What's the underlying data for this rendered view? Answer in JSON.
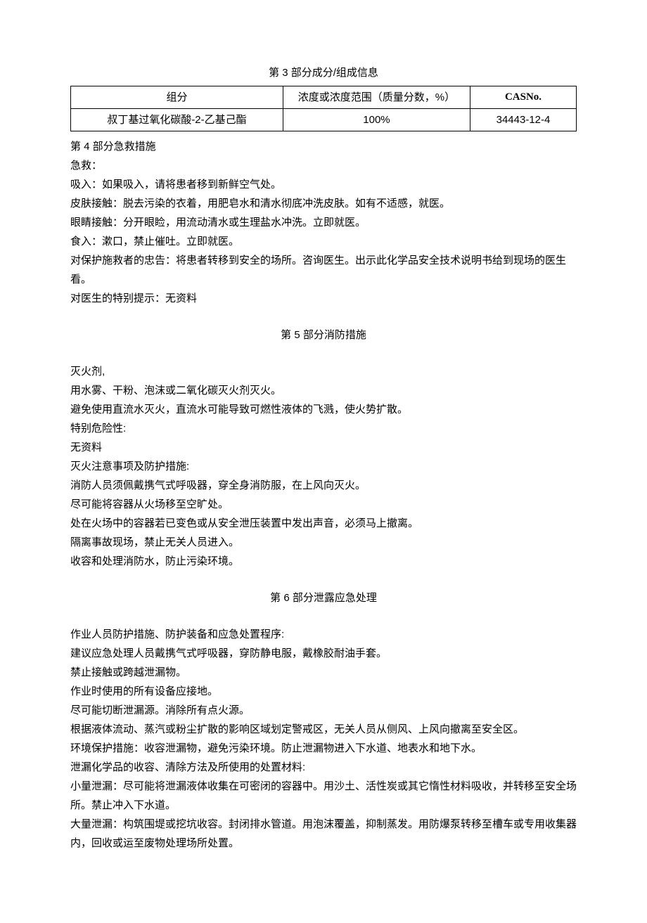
{
  "section3": {
    "title": "第 3 部分成分/组成信息",
    "table": {
      "headers": {
        "component": "组分",
        "concentration": "浓度或浓度范围（质量分数，%）",
        "cas": "CASNo."
      },
      "row": {
        "component": "叔丁基过氧化碳酸-2-乙基己酯",
        "concentration": "100%",
        "cas": "34443-12-4"
      }
    }
  },
  "section4": {
    "title": "第 4 部分急救措施",
    "lines": {
      "l1": "急救：",
      "l2": "吸入：如果吸入，请将患者移到新鲜空气处。",
      "l3": "皮肤接触：脱去污染的衣着，用肥皂水和清水彻底冲洗皮肤。如有不适感，就医。",
      "l4": "眼睛接触：分开眼睑，用流动清水或生理盐水冲洗。立即就医。",
      "l5": "食入：漱口，禁止催吐。立即就医。",
      "l6": "对保护施救者的忠告：将患者转移到安全的场所。咨询医生。出示此化学品安全技术说明书给到现场的医生看。",
      "l7": "对医生的特别提示：无资料"
    }
  },
  "section5": {
    "title": "第 5 部分消防措施",
    "lines": {
      "l1": "灭火剂,",
      "l2": "用水雾、干粉、泡沫或二氧化碳灭火剂灭火。",
      "l3": "避免使用直流水灭火，直流水可能导致可燃性液体的飞溅，使火势扩散。",
      "l4": "特别危险性:",
      "l5": "无资料",
      "l6": "灭火注意事项及防护措施:",
      "l7": "消防人员须佩戴携气式呼吸器，穿全身消防服，在上风向灭火。",
      "l8": "尽可能将容器从火场移至空旷处。",
      "l9": "处在火场中的容器若已变色或从安全泄压装置中发出声音，必须马上撤离。",
      "l10": "隔离事故现场，禁止无关人员进入。",
      "l11": "收容和处理消防水，防止污染环境。"
    }
  },
  "section6": {
    "title": "第 6 部分泄露应急处理",
    "lines": {
      "l1": "作业人员防护措施、防护装备和应急处置程序:",
      "l2": "建议应急处理人员戴携气式呼吸器，穿防静电服，戴橡胶耐油手套。",
      "l3": "禁止接触或跨越泄漏物。",
      "l4": "作业时使用的所有设备应接地。",
      "l5": "尽可能切断泄漏源。消除所有点火源。",
      "l6": "根据液体流动、蒸汽或粉尘扩散的影响区域划定警戒区，无关人员从侧风、上风向撤离至安全区。",
      "l7": "环境保护措施：收容泄漏物，避免污染环境。防止泄漏物进入下水道、地表水和地下水。",
      "l8": "泄漏化学品的收容、清除方法及所使用的处置材料:",
      "l9": "小量泄漏：尽可能将泄漏液体收集在可密闭的容器中。用沙土、活性炭或其它惰性材料吸收，并转移至安全场所。禁止冲入下水道。",
      "l10": "大量泄漏：构筑围堤或挖坑收容。封闭排水管道。用泡沫覆盖，抑制蒸发。用防爆泵转移至槽车或专用收集器内，回收或运至废物处理场所处置。"
    }
  }
}
